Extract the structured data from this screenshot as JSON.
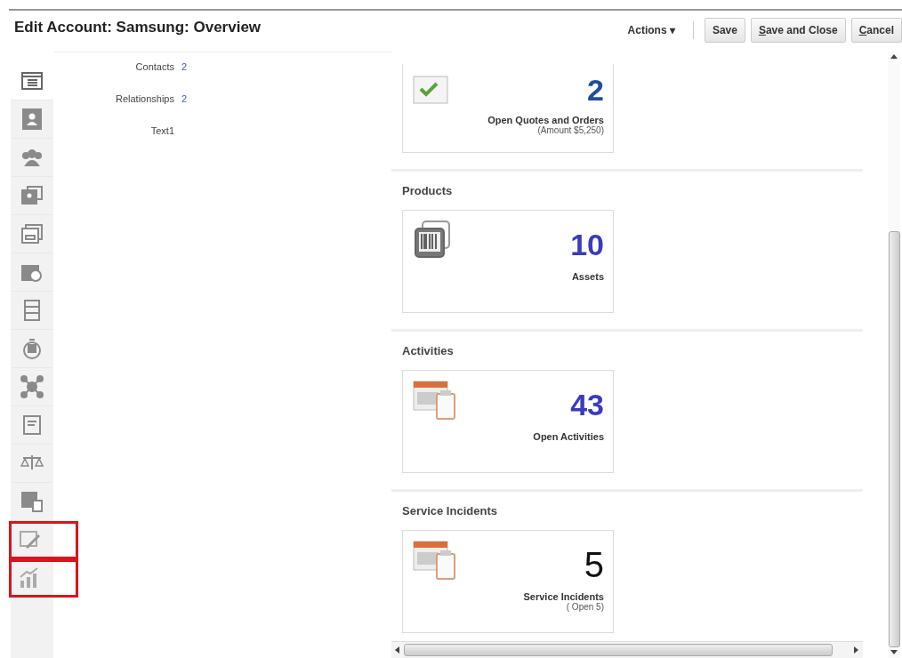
{
  "header": {
    "title": "Edit Account: Samsung: Overview",
    "actions_menu": "Actions ▾",
    "buttons": [
      {
        "rest": "Save"
      },
      {
        "key": "S",
        "rest": "ave and Close"
      },
      {
        "key": "C",
        "rest": "ancel"
      }
    ]
  },
  "rail": [
    {
      "kind": "list",
      "selected": true,
      "highlighted": false
    },
    {
      "kind": "contact",
      "selected": false,
      "highlighted": false
    },
    {
      "kind": "people",
      "selected": false,
      "highlighted": false
    },
    {
      "kind": "idcard",
      "selected": false,
      "highlighted": false
    },
    {
      "kind": "calendar",
      "selected": false,
      "highlighted": false
    },
    {
      "kind": "camera",
      "selected": false,
      "highlighted": false
    },
    {
      "kind": "checklist",
      "selected": false,
      "highlighted": false
    },
    {
      "kind": "timer",
      "selected": false,
      "highlighted": false
    },
    {
      "kind": "network",
      "selected": false,
      "highlighted": false
    },
    {
      "kind": "note",
      "selected": false,
      "highlighted": false
    },
    {
      "kind": "scales",
      "selected": false,
      "highlighted": false
    },
    {
      "kind": "table",
      "selected": false,
      "highlighted": false
    },
    {
      "kind": "edit",
      "selected": false,
      "highlighted": true
    },
    {
      "kind": "chart",
      "selected": false,
      "highlighted": true
    }
  ],
  "fields": [
    {
      "label": "Contacts",
      "value": "2"
    },
    {
      "label": "Relationships",
      "value": "2"
    },
    {
      "label": "Text1"
    }
  ],
  "sections": [
    {
      "tile": {
        "kind": "check",
        "count": "2",
        "color": "#1f4e9a",
        "label": "Open Quotes and Orders",
        "sub": "(Amount $5,250)"
      }
    },
    {
      "title": "Products",
      "tile": {
        "kind": "barcode",
        "count": "10",
        "color": "#3a3bc0",
        "label": "Assets"
      }
    },
    {
      "title": "Activities",
      "tile": {
        "kind": "calendar",
        "count": "43",
        "color": "#3a3bc0",
        "label": "Open Activities"
      }
    },
    {
      "title": "Service Incidents",
      "tile": {
        "kind": "calendar",
        "count": "5",
        "color": "#111111",
        "label": "Service Incidents",
        "sub": "( Open 5)"
      }
    }
  ]
}
